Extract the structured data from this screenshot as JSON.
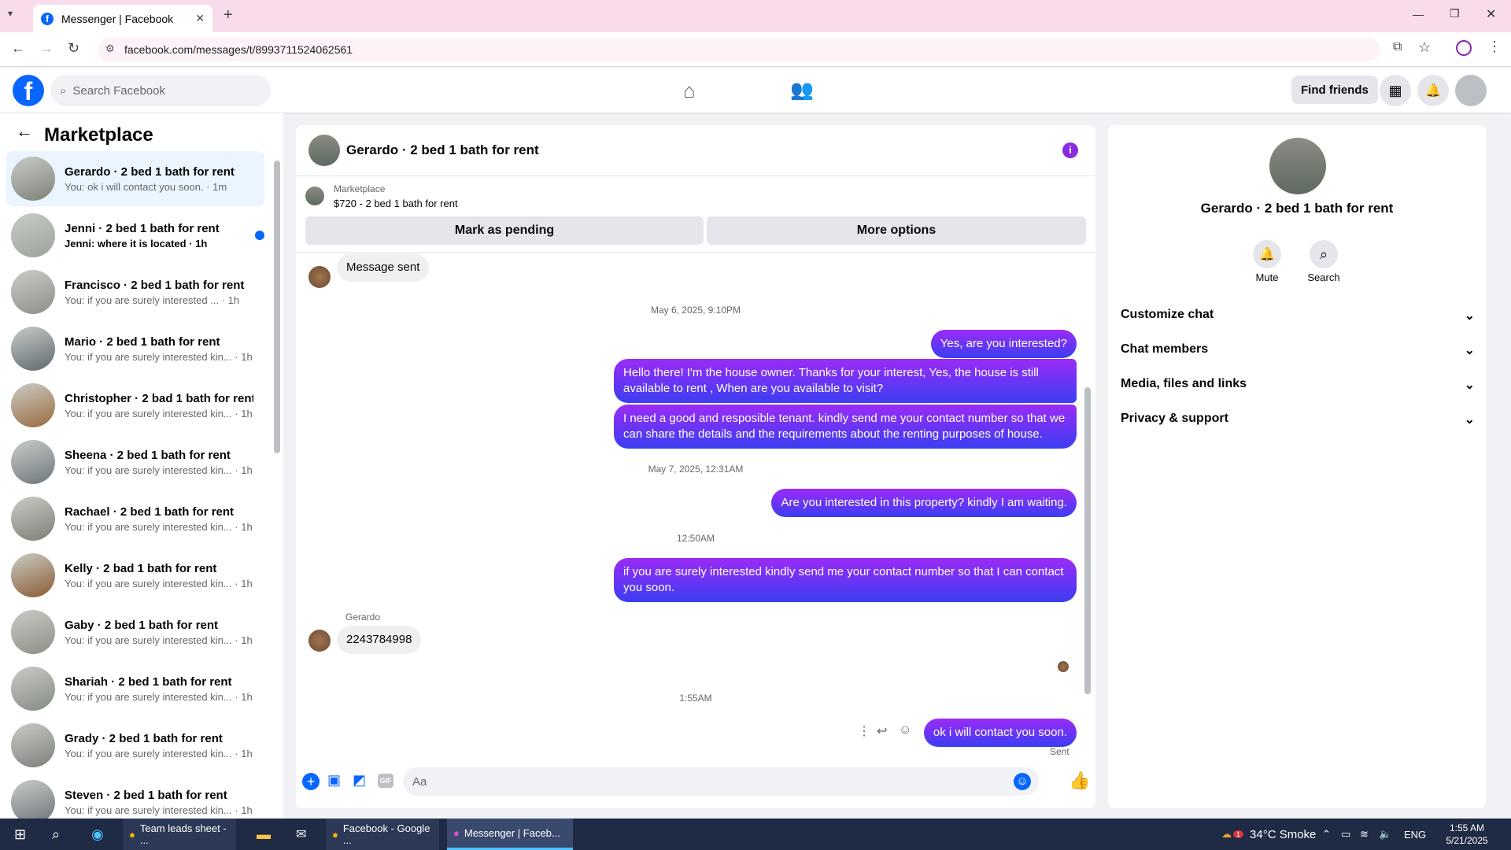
{
  "browser": {
    "tab_title": "Messenger | Facebook",
    "url": "facebook.com/messages/t/8993711524062561"
  },
  "header": {
    "search_placeholder": "Search Facebook",
    "find_friends": "Find friends"
  },
  "sidebar": {
    "title": "Marketplace",
    "conversations": [
      {
        "name": "Gerardo · 2 bed 1 bath for rent",
        "snippet": "You: ok i will contact you soon. · 1m",
        "active": true,
        "unread": false
      },
      {
        "name": "Jenni · 2 bed 1 bath for rent",
        "snippet": "Jenni: where it is located · 1h",
        "active": false,
        "unread": true
      },
      {
        "name": "Francisco · 2 bed 1 bath for rent",
        "snippet": "You: if you are surely interested ... · 1h",
        "active": false,
        "unread": false
      },
      {
        "name": "Mario · 2 bed 1 bath for rent",
        "snippet": "You: if you are surely interested kin... · 1h",
        "active": false,
        "unread": false
      },
      {
        "name": "Christopher · 2 bad 1 bath for rent",
        "snippet": "You: if you are surely interested kin... · 1h",
        "active": false,
        "unread": false
      },
      {
        "name": "Sheena · 2 bed 1 bath for rent",
        "snippet": "You: if you are surely interested kin... · 1h",
        "active": false,
        "unread": false
      },
      {
        "name": "Rachael · 2 bed 1 bath for rent",
        "snippet": "You: if you are surely interested kin... · 1h",
        "active": false,
        "unread": false
      },
      {
        "name": "Kelly · 2 bad 1 bath for rent",
        "snippet": "You: if you are surely interested kin... · 1h",
        "active": false,
        "unread": false
      },
      {
        "name": "Gaby · 2 bed 1 bath for rent",
        "snippet": "You: if you are surely interested kin... · 1h",
        "active": false,
        "unread": false
      },
      {
        "name": "Shariah · 2 bed 1 bath for rent",
        "snippet": "You: if you are surely interested kin... · 1h",
        "active": false,
        "unread": false
      },
      {
        "name": "Grady · 2 bed 1 bath for rent",
        "snippet": "You: if you are surely interested kin... · 1h",
        "active": false,
        "unread": false
      },
      {
        "name": "Steven · 2 bed 1 bath for rent",
        "snippet": "You: if you are surely interested kin... · 1h",
        "active": false,
        "unread": false
      }
    ]
  },
  "chat": {
    "title": "Gerardo · 2 bed 1 bath for rent",
    "listing_source": "Marketplace",
    "listing_title": "$720 - 2 bed 1 bath for rent",
    "mark_pending": "Mark as pending",
    "more_options": "More options",
    "msg_sent_label": "Message sent",
    "stamp1": "May 6, 2025, 9:10PM",
    "out1": "Yes, are you interested?",
    "out2": "Hello there! I'm the house owner. Thanks for your interest, Yes, the house is still available to rent , When are you available to visit?",
    "out3": "I need a good and resposible tenant.  kindly send me your contact number so that we can share the details and the requirements about the renting purposes of house.",
    "stamp2": "May 7, 2025, 12:31AM",
    "out4": "Are you interested in this property? kindly I am waiting.",
    "stamp3": "12:50AM",
    "out5": "if you are surely interested kindly send me your contact number so that I can contact you soon.",
    "sender": "Gerardo",
    "in1": "2243784998",
    "stamp4": "1:55AM",
    "out6": "ok i will contact you soon.",
    "sent_status": "Sent",
    "composer_placeholder": "Aa"
  },
  "details": {
    "name": "Gerardo · 2 bed 1 bath for rent",
    "mute": "Mute",
    "search": "Search",
    "sections": [
      "Customize chat",
      "Chat members",
      "Media, files and links",
      "Privacy & support"
    ]
  },
  "taskbar": {
    "app1": "Team leads sheet - ...",
    "app2": "Facebook - Google ...",
    "app3": "Messenger | Faceb...",
    "weather": "34°C  Smoke",
    "lang": "ENG",
    "time": "1:55 AM",
    "date": "5/21/2025",
    "badge": "1"
  },
  "colors": {
    "fb_blue": "#0866ff",
    "accent_purple": "#8a2be2"
  }
}
